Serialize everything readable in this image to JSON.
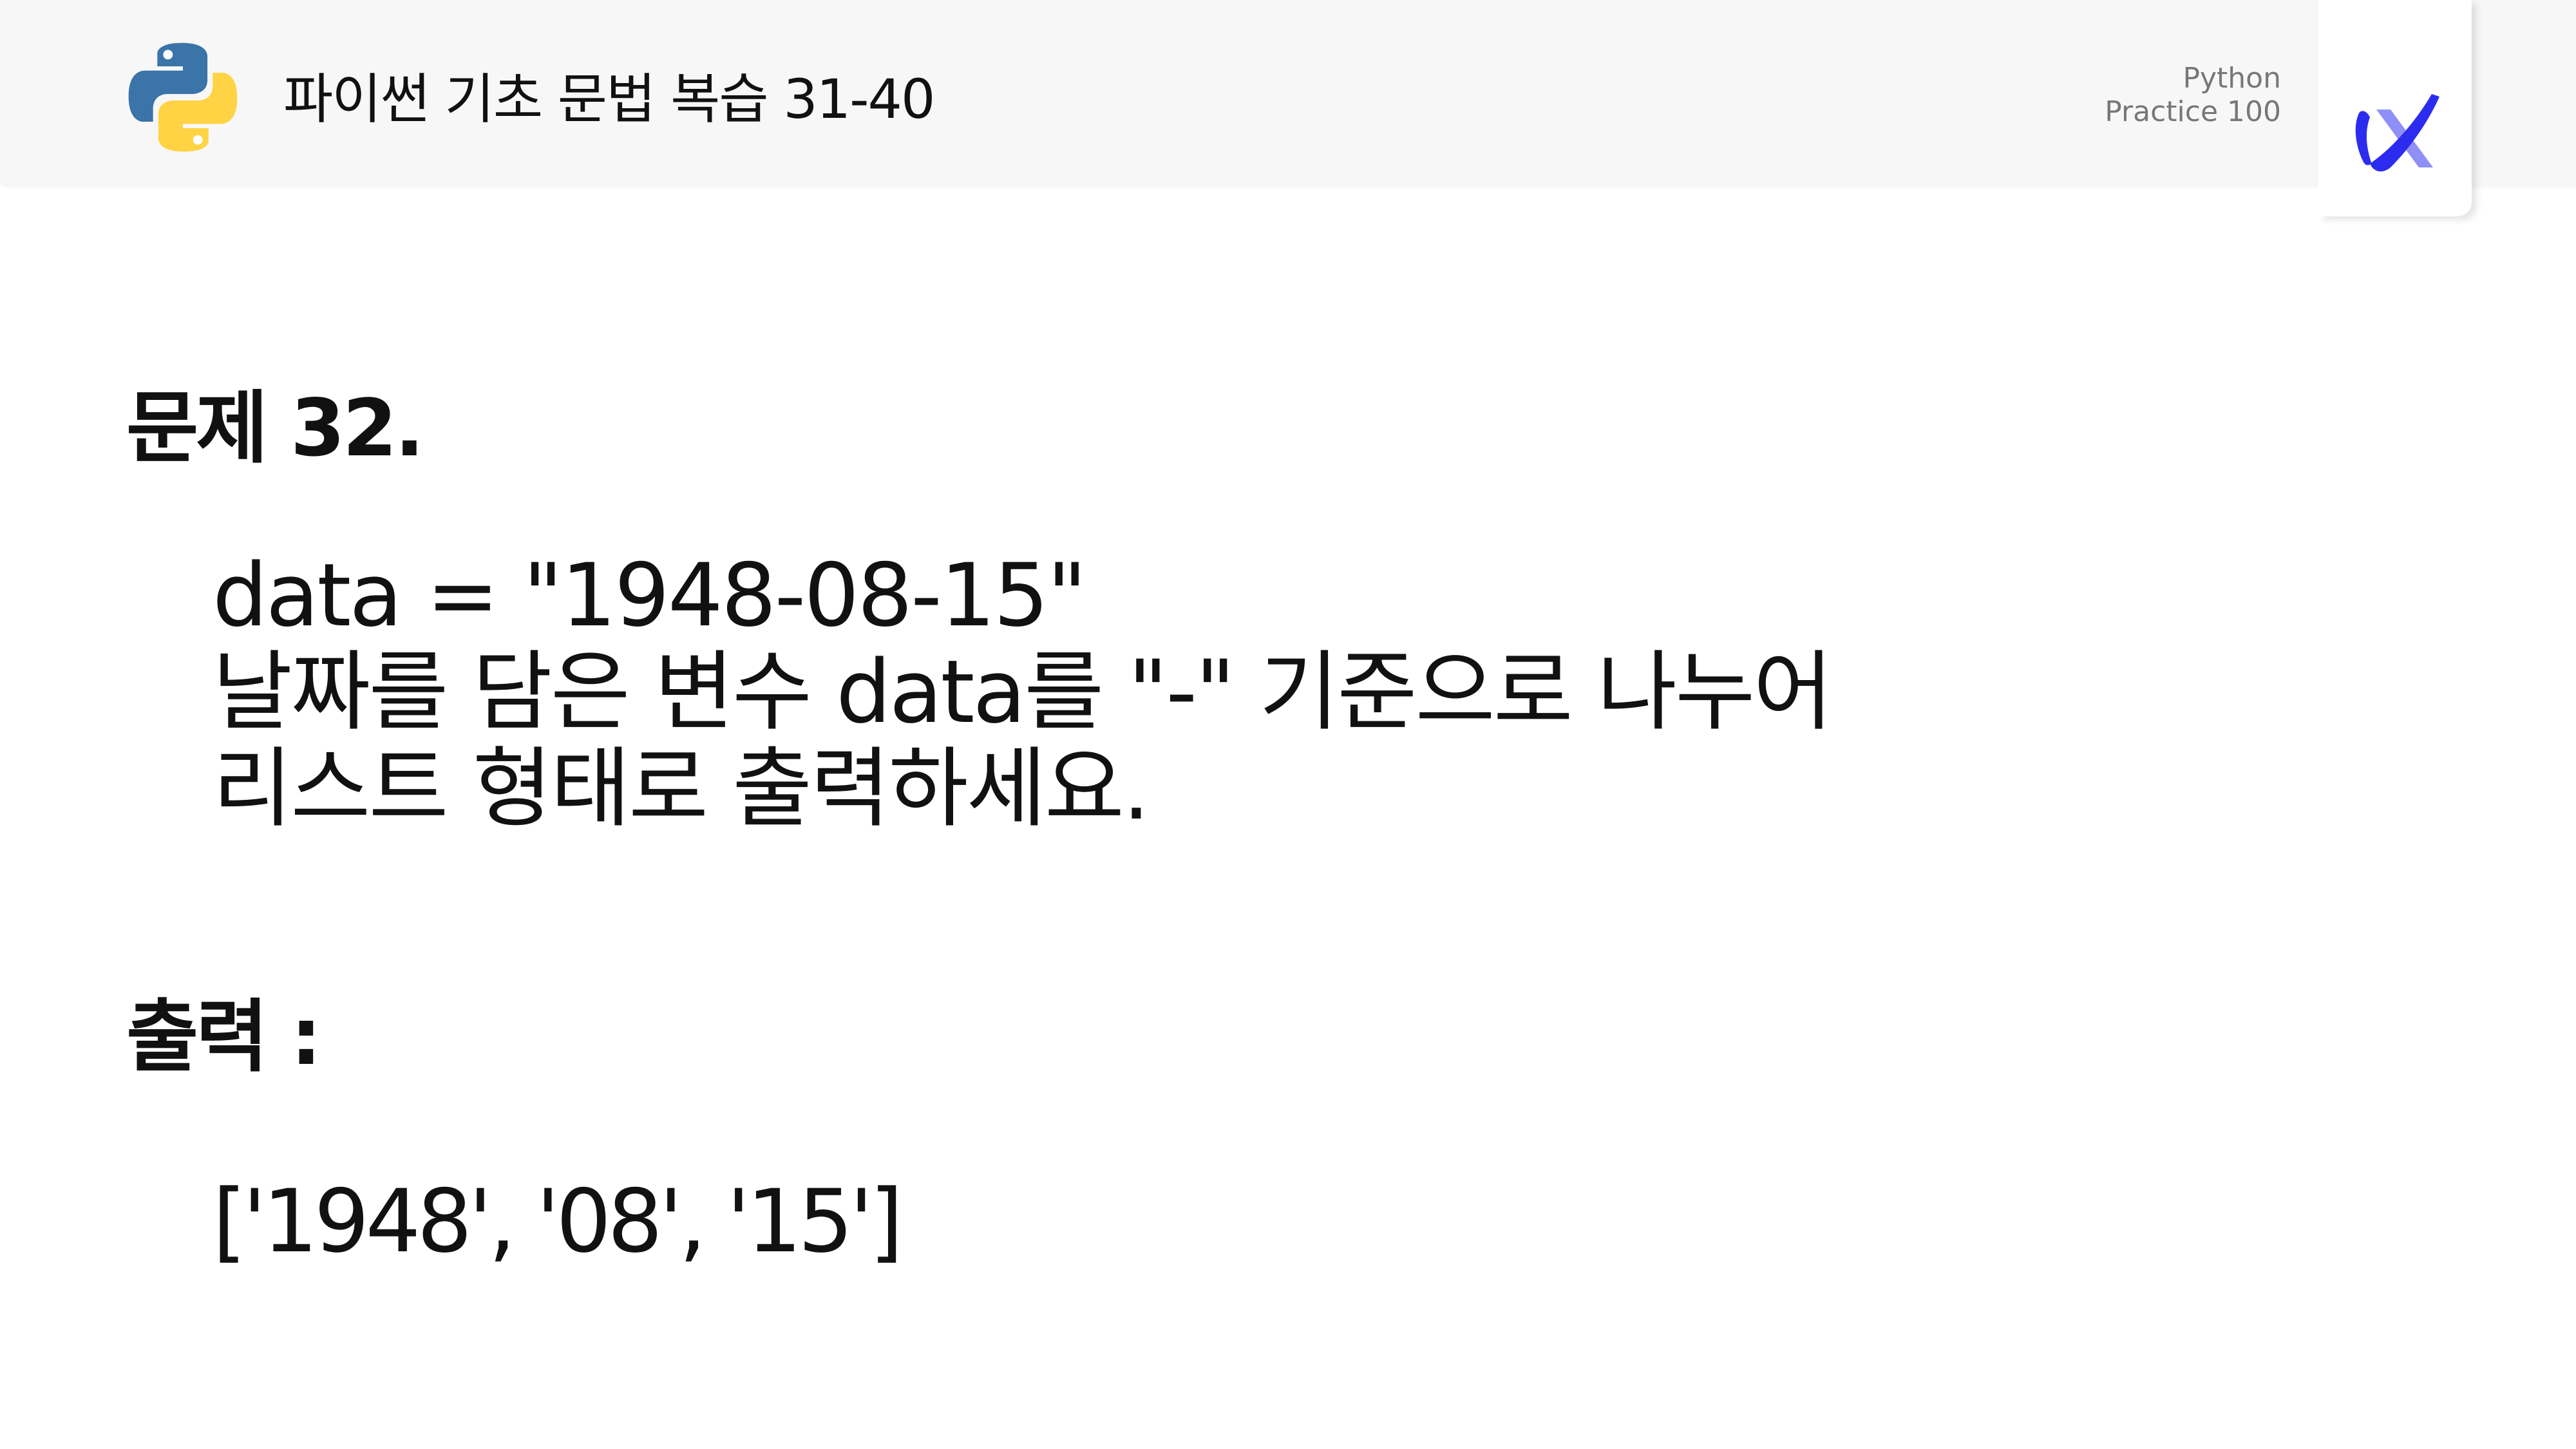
{
  "header": {
    "title": "파이썬 기초 문법 복습 31-40",
    "subtitle_line1": "Python",
    "subtitle_line2": "Practice 100",
    "python_logo_icon": "python-logo-icon",
    "brand_logo_icon": "brand-x-logo-icon"
  },
  "problem": {
    "title": "문제 32.",
    "lines": [
      "data = \"1948-08-15\"",
      "날짜를 담은 변수 data를 \"-\" 기준으로 나누어",
      "리스트 형태로 출력하세요."
    ]
  },
  "output": {
    "label": "출력 :",
    "value": "['1948', '08', '15']"
  },
  "colors": {
    "header_bg": "#f7f7f7",
    "python_blue": "#3a74a8",
    "python_yellow": "#ffd343",
    "brand_blue": "#2c2cf0",
    "brand_light": "#8f8ff8",
    "text": "#111111",
    "subtitle_text": "#777777"
  }
}
